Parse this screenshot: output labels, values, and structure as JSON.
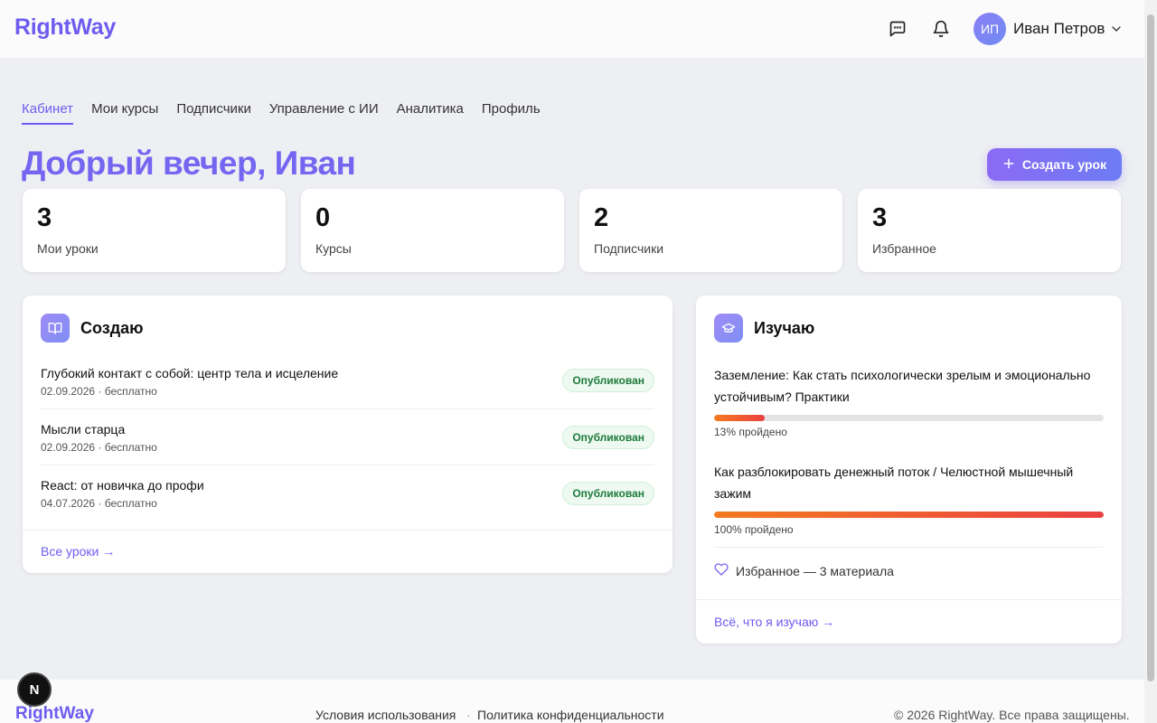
{
  "header": {
    "logo": "RightWay",
    "user": {
      "initials": "ИП",
      "name": "Иван Петров"
    }
  },
  "tabs": [
    {
      "label": "Кабинет",
      "active": true
    },
    {
      "label": "Мои курсы"
    },
    {
      "label": "Подписчики"
    },
    {
      "label": "Управление с ИИ"
    },
    {
      "label": "Аналитика"
    },
    {
      "label": "Профиль"
    }
  ],
  "greeting": "Добрый вечер, Иван",
  "create_button": "Создать урок",
  "stats": [
    {
      "value": "3",
      "label": "Мои уроки"
    },
    {
      "value": "0",
      "label": "Курсы"
    },
    {
      "value": "2",
      "label": "Подписчики"
    },
    {
      "value": "3",
      "label": "Избранное"
    }
  ],
  "creating": {
    "title": "Создаю",
    "lessons": [
      {
        "title": "Глубокий контакт с собой: центр тела и исцеление",
        "meta": "02.09.2026 · бесплатно",
        "status": "Опубликован"
      },
      {
        "title": "Мысли старца",
        "meta": "02.09.2026 · бесплатно",
        "status": "Опубликован"
      },
      {
        "title": "React: от новичка до профи",
        "meta": "04.07.2026 · бесплатно",
        "status": "Опубликован"
      }
    ],
    "link": "Все уроки →"
  },
  "studying": {
    "title": "Изучаю",
    "items": [
      {
        "title": "Заземление: Как стать психологически зрелым и эмоционально устойчивым? Практики",
        "progress": 13,
        "progress_text": "13% пройдено"
      },
      {
        "title": "Как разблокировать денежный поток / Челюстной мышечный зажим",
        "progress": 100,
        "progress_text": "100% пройдено"
      }
    ],
    "favorites": "Избранное — 3 материала",
    "link": "Всё, что я изучаю →"
  },
  "footer": {
    "logo": "RightWay",
    "terms": "Условия использования",
    "dot": "·",
    "privacy": "Политика конфиденциальности",
    "copyright": "© 2026 RightWay. Все права защищены."
  },
  "dev_badge": "N",
  "colors": {
    "accent": "#6e5cf0",
    "progress_start": "#f57a20",
    "progress_end": "#ea4141",
    "success": "#1e7a3c"
  }
}
